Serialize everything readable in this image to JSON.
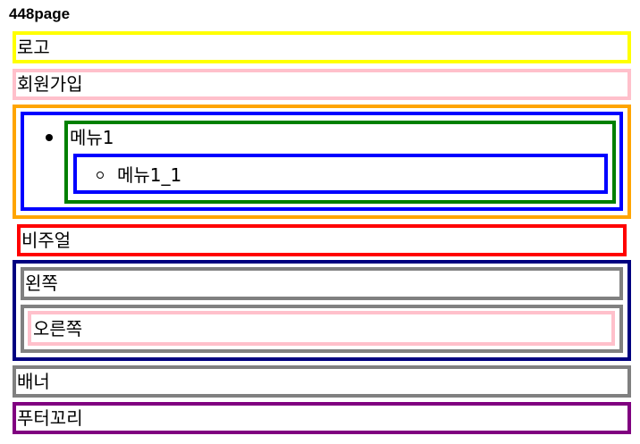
{
  "page": {
    "title": "448page"
  },
  "sections": {
    "logo": "로고",
    "signup": "회원가입",
    "menu": {
      "item": "메뉴1",
      "subitem": "메뉴1_1"
    },
    "visual": "비주얼",
    "left": "왼쪽",
    "right": "오른쪽",
    "banner": "배너",
    "footer": "푸터꼬리"
  },
  "colors": {
    "logo_border": "#ffff00",
    "signup_border": "#ffc0cb",
    "menu_outer_border": "#ffa500",
    "menu_list_border": "#0000ff",
    "menu_item_border": "#008000",
    "submenu_border": "#0000ff",
    "visual_border": "#ff0000",
    "content_border": "#000080",
    "left_border": "#808080",
    "right_outer_border": "#808080",
    "right_inner_border": "#ffc0cb",
    "banner_border": "#808080",
    "footer_border": "#800080"
  }
}
